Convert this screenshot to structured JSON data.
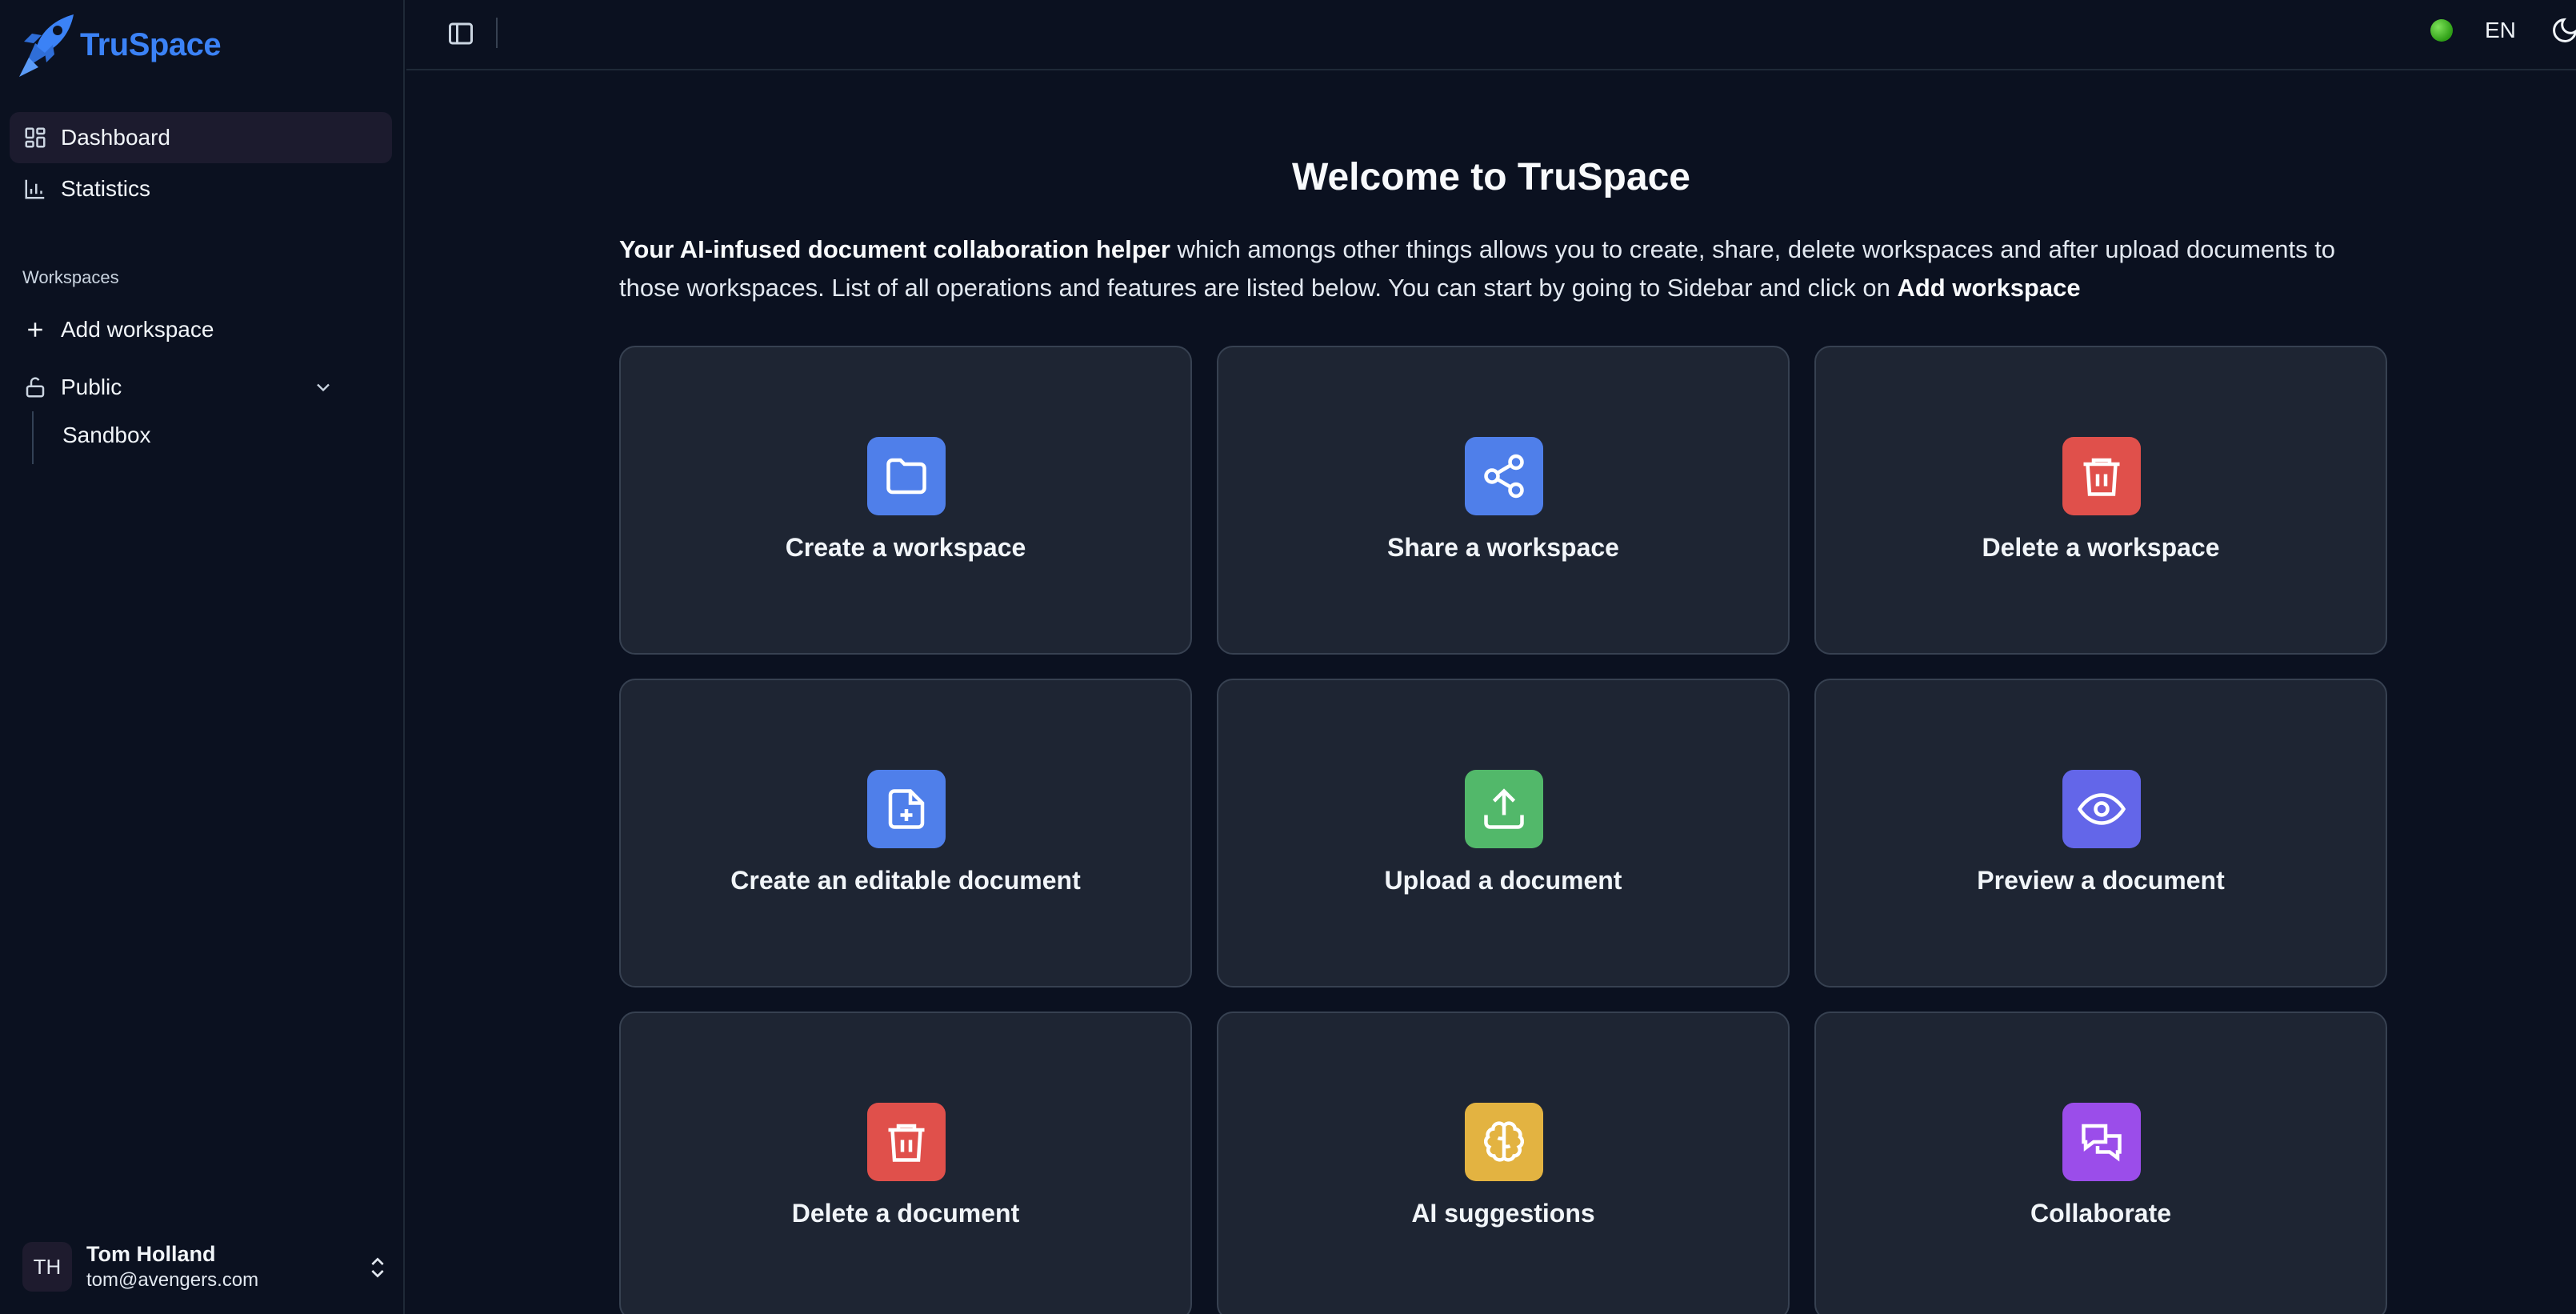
{
  "app": {
    "name": "TruSpace"
  },
  "sidebar": {
    "nav": [
      {
        "label": "Dashboard",
        "icon": "dashboard-icon",
        "active": true
      },
      {
        "label": "Statistics",
        "icon": "bar-chart-icon",
        "active": false
      }
    ],
    "section_label": "Workspaces",
    "add_workspace": "Add workspace",
    "group": {
      "label": "Public",
      "icon": "unlock-icon",
      "expanded": true
    },
    "sub_items": [
      "Sandbox"
    ],
    "user": {
      "initials": "TH",
      "name": "Tom Holland",
      "email": "tom@avengers.com"
    }
  },
  "topbar": {
    "language": "EN",
    "status_color": "#3fbf25"
  },
  "main": {
    "title": "Welcome to TruSpace",
    "intro": {
      "bold_lead": "Your AI-infused document collaboration helper",
      "body": " which amongs other things allows you to create, share, delete workspaces and after upload documents to those workspaces. List of all operations and features are listed below. You can start by going to Sidebar and click on ",
      "bold_tail": "Add workspace"
    },
    "cards": [
      {
        "label": "Create a workspace",
        "icon": "folder-icon",
        "color": "#4f7fea"
      },
      {
        "label": "Share a workspace",
        "icon": "share-icon",
        "color": "#4f7fea"
      },
      {
        "label": "Delete a workspace",
        "icon": "trash-icon",
        "color": "#e0504b"
      },
      {
        "label": "Create an editable document",
        "icon": "file-plus-icon",
        "color": "#4f7fea"
      },
      {
        "label": "Upload a document",
        "icon": "upload-icon",
        "color": "#52b86a"
      },
      {
        "label": "Preview a document",
        "icon": "eye-icon",
        "color": "#6366e9"
      },
      {
        "label": "Delete a document",
        "icon": "trash-icon",
        "color": "#e0504b"
      },
      {
        "label": "AI suggestions",
        "icon": "brain-icon",
        "color": "#e3b341"
      },
      {
        "label": "Collaborate",
        "icon": "chat-icon",
        "color": "#9b4dea"
      }
    ]
  }
}
